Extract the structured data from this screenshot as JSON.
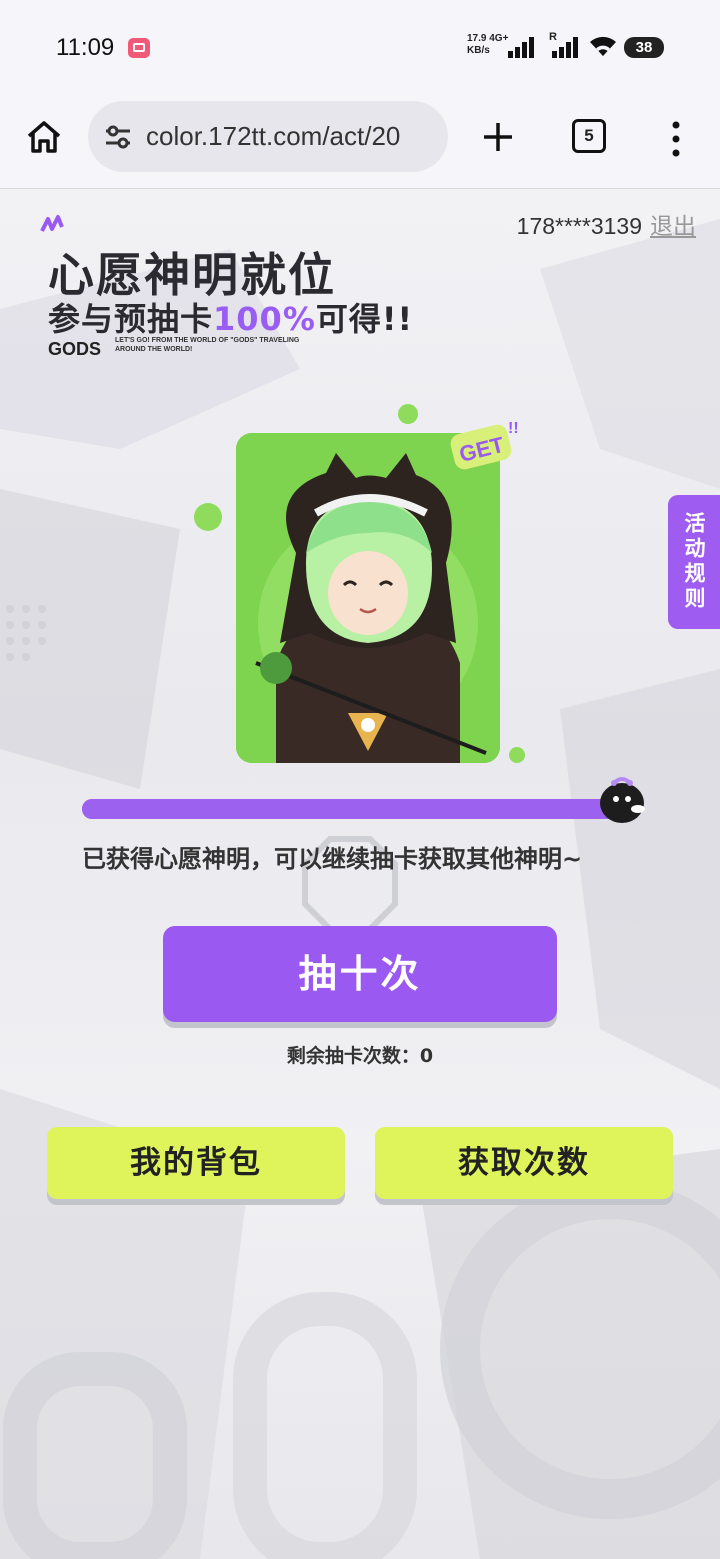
{
  "status_bar": {
    "time": "11:09",
    "net_speed_top": "17.9 4G+",
    "net_speed_bottom": "KB/s",
    "roaming_label": "R",
    "battery": "38"
  },
  "browser": {
    "url": "color.172tt.com/act/20",
    "tab_count": "5"
  },
  "header": {
    "user_phone": "178****3139",
    "logout_label": "退出"
  },
  "hero": {
    "title": "心愿神明就位",
    "subtitle_prefix": "参与预抽卡",
    "subtitle_highlight": "100%",
    "subtitle_suffix": "可得!!",
    "brand": "GODS",
    "brand_tagline": "LET'S GO! FROM THE WORLD OF \"GODS\" TRAVELING AROUND THE WORLD!"
  },
  "card": {
    "badge": "GET"
  },
  "side_tab": {
    "label": "活动规则"
  },
  "progress": {
    "fraction": 1.0,
    "message": "已获得心愿神明，可以继续抽卡获取其他神明~"
  },
  "actions": {
    "draw_ten_label": "抽十次",
    "remaining_label": "剩余抽卡次数：0",
    "backpack_label": "我的背包",
    "get_chances_label": "获取次数"
  },
  "colors": {
    "accent_purple": "#9a5af1",
    "accent_yellow": "#dff45b",
    "card_green": "#7ed34f"
  }
}
